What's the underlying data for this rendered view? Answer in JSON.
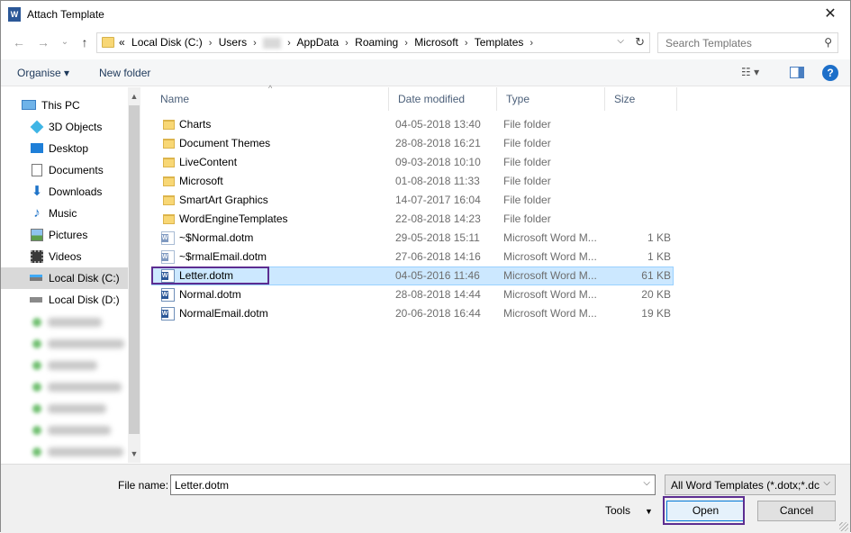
{
  "window": {
    "title": "Attach Template",
    "close_glyph": "✕",
    "app_icon": "W"
  },
  "nav": {
    "back": "←",
    "forward": "→",
    "recent": "⌄",
    "up": "↑"
  },
  "address": {
    "crumbs": [
      "Local Disk (C:)",
      "Users",
      "AppData",
      "Roaming",
      "Microsoft",
      "Templates"
    ],
    "prefix": "«",
    "dropdown": "⌵",
    "refresh": "↻"
  },
  "search": {
    "placeholder": "Search Templates",
    "icon": "⚲"
  },
  "toolbar": {
    "organise": "Organise ▾",
    "new_folder": "New folder",
    "help": "?",
    "views": "☷ ▾"
  },
  "sidebar": {
    "items": [
      {
        "label": "This PC",
        "icon": "monitor-icon"
      },
      {
        "label": "3D Objects",
        "icon": "cube-icon"
      },
      {
        "label": "Desktop",
        "icon": "desktop-icon"
      },
      {
        "label": "Documents",
        "icon": "documents-icon"
      },
      {
        "label": "Downloads",
        "icon": "downloads-icon"
      },
      {
        "label": "Music",
        "icon": "music-icon"
      },
      {
        "label": "Pictures",
        "icon": "pictures-icon"
      },
      {
        "label": "Videos",
        "icon": "videos-icon"
      },
      {
        "label": "Local Disk (C:)",
        "icon": "drive-icon",
        "selected": true
      },
      {
        "label": "Local Disk (D:)",
        "icon": "drive-icon"
      }
    ]
  },
  "columns": {
    "name": "Name",
    "date": "Date modified",
    "type": "Type",
    "size": "Size"
  },
  "files": [
    {
      "name": "Charts",
      "date": "04-05-2018 13:40",
      "type": "File folder",
      "size": "",
      "kind": "folder"
    },
    {
      "name": "Document Themes",
      "date": "28-08-2018 16:21",
      "type": "File folder",
      "size": "",
      "kind": "folder"
    },
    {
      "name": "LiveContent",
      "date": "09-03-2018 10:10",
      "type": "File folder",
      "size": "",
      "kind": "folder"
    },
    {
      "name": "Microsoft",
      "date": "01-08-2018 11:33",
      "type": "File folder",
      "size": "",
      "kind": "folder"
    },
    {
      "name": "SmartArt Graphics",
      "date": "14-07-2017 16:04",
      "type": "File folder",
      "size": "",
      "kind": "folder"
    },
    {
      "name": "WordEngineTemplates",
      "date": "22-08-2018 14:23",
      "type": "File folder",
      "size": "",
      "kind": "folder"
    },
    {
      "name": "~$Normal.dotm",
      "date": "29-05-2018 15:11",
      "type": "Microsoft Word M...",
      "size": "1 KB",
      "kind": "doc"
    },
    {
      "name": "~$rmalEmail.dotm",
      "date": "27-06-2018 14:16",
      "type": "Microsoft Word M...",
      "size": "1 KB",
      "kind": "doc"
    },
    {
      "name": "Letter.dotm",
      "date": "04-05-2016 11:46",
      "type": "Microsoft Word M...",
      "size": "61 KB",
      "kind": "doc",
      "selected": true
    },
    {
      "name": "Normal.dotm",
      "date": "28-08-2018 14:44",
      "type": "Microsoft Word M...",
      "size": "20 KB",
      "kind": "doc"
    },
    {
      "name": "NormalEmail.dotm",
      "date": "20-06-2018 16:44",
      "type": "Microsoft Word M...",
      "size": "19 KB",
      "kind": "doc"
    }
  ],
  "footer": {
    "file_name_label": "File name:",
    "file_name_value": "Letter.dotm",
    "filter": "All Word Templates (*.dotx;*.dc",
    "tools": "Tools",
    "open": "Open",
    "cancel": "Cancel"
  }
}
